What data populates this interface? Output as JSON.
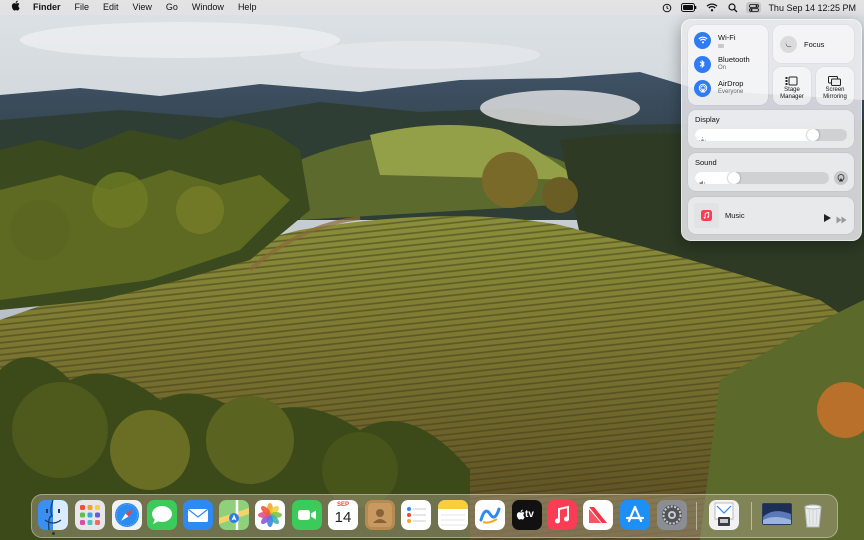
{
  "menubar": {
    "app_name": "Finder",
    "menus": [
      "File",
      "Edit",
      "View",
      "Go",
      "Window",
      "Help"
    ],
    "clock": "Thu Sep 14  12:25 PM",
    "status_icons": [
      "time-machine-icon",
      "battery-icon",
      "wifi-icon",
      "search-icon",
      "control-center-icon"
    ]
  },
  "control_center": {
    "wifi": {
      "label": "Wi-Fi",
      "status": ""
    },
    "bluetooth": {
      "label": "Bluetooth",
      "status": "On"
    },
    "airdrop": {
      "label": "AirDrop",
      "status": "Everyone"
    },
    "focus": {
      "label": "Focus"
    },
    "stage_manager": {
      "label_line1": "Stage",
      "label_line2": "Manager"
    },
    "screen_mirroring": {
      "label_line1": "Screen",
      "label_line2": "Mirroring"
    },
    "display": {
      "label": "Display",
      "level": 0.8
    },
    "sound": {
      "label": "Sound",
      "level": 0.27
    },
    "music": {
      "label": "Music"
    }
  },
  "dock": {
    "apps": [
      "Finder",
      "Launchpad",
      "Safari",
      "Messages",
      "Mail",
      "Maps",
      "Photos",
      "FaceTime",
      "Calendar",
      "Contacts",
      "Reminders",
      "Notes",
      "Freeform",
      "TV",
      "Music",
      "News",
      "App Store",
      "System Settings",
      "Preview",
      "Downloads",
      "Trash"
    ],
    "calendar": {
      "month": "SEP",
      "day": "14"
    },
    "tv_label": "tv"
  },
  "colors": {
    "accent": "#2f7bf5",
    "menubar": "#e8e4e0"
  }
}
